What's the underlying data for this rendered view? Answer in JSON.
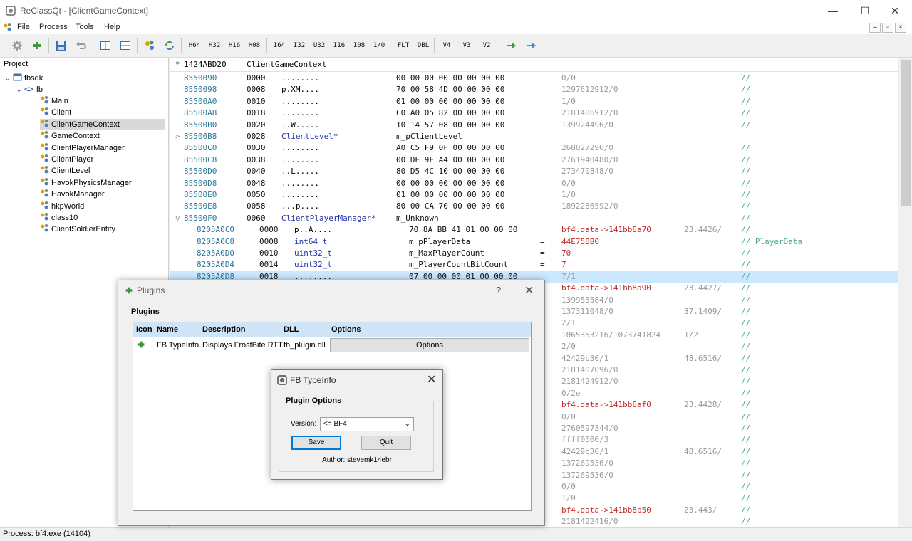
{
  "window": {
    "title": "ReClassQt - [ClientGameContext]",
    "controls": {
      "minimize": "—",
      "maximize": "☐",
      "close": "✕"
    }
  },
  "menu": {
    "items": [
      "File",
      "Process",
      "Tools",
      "Help"
    ],
    "mdi": {
      "minimize": "–",
      "restore": "▫",
      "close": "×"
    }
  },
  "toolbar": {
    "type_buttons": [
      "H64",
      "H32",
      "H16",
      "H08",
      "I64",
      "I32",
      "U32",
      "I16",
      "I08",
      "1/0",
      "FLT",
      "DBL",
      "V4",
      "V3",
      "V2"
    ],
    "icons": [
      "gear-icon",
      "plugin-icon",
      "save-icon",
      "undo-icon",
      "split-vertical-icon",
      "split-horizontal-icon",
      "add-class-icon",
      "refresh-icon",
      "arrow-right-green-icon",
      "arrow-right-blue-icon"
    ]
  },
  "project": {
    "header": "Project",
    "root": "fbsdk",
    "namespace": "fb",
    "classes": [
      "Main",
      "Client",
      "ClientGameContext",
      "GameContext",
      "ClientPlayerManager",
      "ClientPlayer",
      "ClientLevel",
      "HavokPhysicsManager",
      "HavokManager",
      "hkpWorld",
      "class10",
      "ClientSoldierEntity"
    ],
    "selected": "ClientGameContext"
  },
  "hexview": {
    "header_addr": "1424ABD20",
    "header_class": "ClientGameContext",
    "rows": [
      {
        "addr": "8550090",
        "off": "0000",
        "ascii": "........",
        "hex": "00 00 00 00 00 00 00 00",
        "num": "0/0",
        "cmt": "//"
      },
      {
        "addr": "8550098",
        "off": "0008",
        "ascii": "p.XM....",
        "hex": "70 00 58 4D 00 00 00 00",
        "num": "1297612912/0",
        "cmt": "//"
      },
      {
        "addr": "85500A0",
        "off": "0010",
        "ascii": "........",
        "hex": "01 00 00 00 00 00 00 00",
        "num": "1/0",
        "cmt": "//"
      },
      {
        "addr": "85500A8",
        "off": "0018",
        "ascii": "........",
        "hex": "C0 A0 05 82 00 00 00 00",
        "num": "2181406912/0",
        "cmt": "//"
      },
      {
        "addr": "85500B0",
        "off": "0020",
        "ascii": "..W.....",
        "hex": "10 14 57 08 00 00 00 00",
        "num": "139924496/0",
        "cmt": "//"
      },
      {
        "addr": "85500B8",
        "off": "0028",
        "ptr": "ClientLevel*",
        "name": "m_pClientLevel",
        "expand": ">"
      },
      {
        "addr": "85500C0",
        "off": "0030",
        "ascii": "........",
        "hex": "A0 C5 F9 0F 00 00 00 00",
        "num": "268027296/0",
        "cmt": "//"
      },
      {
        "addr": "85500C8",
        "off": "0038",
        "ascii": "........",
        "hex": "00 DE 9F A4 00 00 00 00",
        "num": "2761940480/0",
        "cmt": "//"
      },
      {
        "addr": "85500D0",
        "off": "0040",
        "ascii": "..L.....",
        "hex": "80 D5 4C 10 00 00 00 00",
        "num": "273470848/0",
        "cmt": "//"
      },
      {
        "addr": "85500D8",
        "off": "0048",
        "ascii": "........",
        "hex": "00 00 00 00 00 00 00 00",
        "num": "0/0",
        "cmt": "//"
      },
      {
        "addr": "85500E0",
        "off": "0050",
        "ascii": "........",
        "hex": "01 00 00 00 00 00 00 00",
        "num": "1/0",
        "cmt": "//"
      },
      {
        "addr": "85500E8",
        "off": "0058",
        "ascii": "...p....",
        "hex": "80 00 CA 70 00 00 00 00",
        "num": "1892286592/0",
        "cmt": "//"
      },
      {
        "addr": "85500F0",
        "off": "0060",
        "ptr": "ClientPlayerManager*",
        "name": "m_Unknown",
        "expand": "v",
        "cmt": "//"
      }
    ],
    "sub_rows": [
      {
        "addr": "8205A0C0",
        "off": "0000",
        "ascii": "p..A....",
        "hex": "70 8A BB 41 01 00 00 00",
        "val": "bf4.data->141bb8a70",
        "float": "23.4426/",
        "cmt": "//"
      },
      {
        "addr": "8205A0C8",
        "off": "0008",
        "type": "int64_t",
        "name": "m_pPlayerData",
        "eq": "=",
        "val": "44E758B0",
        "cmt": "// PlayerData"
      },
      {
        "addr": "8205A0D0",
        "off": "0010",
        "type": "uint32_t",
        "name": "m_MaxPlayerCount",
        "eq": "=",
        "val": "70",
        "cmt": "//"
      },
      {
        "addr": "8205A0D4",
        "off": "0014",
        "type": "uint32_t",
        "name": "m_PlayerCountBitCount",
        "eq": "=",
        "val": "7",
        "cmt": "//"
      },
      {
        "addr": "8205A0D8",
        "off": "0018",
        "ascii": "........",
        "hex": "07 00 00 00 01 00 00 00",
        "num": "7/1",
        "cmt": "//"
      }
    ],
    "right_rows": [
      {
        "val": "bf4.data->141bb8a90",
        "red": true,
        "float": "23.4427/",
        "cmt": "//"
      },
      {
        "val": "139953584/0",
        "cmt": "//"
      },
      {
        "val": "137311048/0",
        "float": "37.1409/",
        "cmt": "//"
      },
      {
        "val": "2/1",
        "cmt": "//"
      },
      {
        "val": "1065353216/1073741824",
        "float": "1/2",
        "cmt": "//"
      },
      {
        "val": "2/0",
        "cmt": "//"
      },
      {
        "val": "42429b30/1",
        "float": "48.6516/",
        "cmt": "//"
      },
      {
        "val": "2181407096/0",
        "cmt": "//"
      },
      {
        "val": "2181424912/0",
        "cmt": "//"
      },
      {
        "val": "0/2e",
        "cmt": "//"
      },
      {
        "val": "bf4.data->141bb8af0",
        "red": true,
        "float": "23.4428/",
        "cmt": "//"
      },
      {
        "val": "0/0",
        "cmt": "//"
      },
      {
        "val": "2760597344/0",
        "cmt": "//"
      },
      {
        "val": "ffff0000/3",
        "cmt": "//"
      },
      {
        "val": "42429b30/1",
        "float": "48.6516/",
        "cmt": "//"
      },
      {
        "val": "137269536/0",
        "cmt": "//"
      },
      {
        "val": "137269536/0",
        "cmt": "//"
      },
      {
        "val": "0/0",
        "cmt": "//"
      },
      {
        "val": "1/0",
        "cmt": "//"
      },
      {
        "val": "bf4.data->141bb8b50",
        "red": true,
        "float": "23.443/",
        "cmt": "//"
      },
      {
        "val": "2181422416/0",
        "cmt": "//"
      }
    ]
  },
  "plugins_dialog": {
    "title": "Plugins",
    "help": "?",
    "close": "✕",
    "group": "Plugins",
    "columns": [
      "Icon",
      "Name",
      "Description",
      "DLL",
      "Options"
    ],
    "row": {
      "name": "FB TypeInfo",
      "description": "Displays FrostBite RTTI",
      "dll": "fb_plugin.dll",
      "options_button": "Options"
    }
  },
  "fb_dialog": {
    "title": "FB TypeInfo",
    "close": "✕",
    "group": "Plugin Options",
    "version_label": "Version:",
    "version_value": "<= BF4",
    "save": "Save",
    "quit": "Quit",
    "author": "Author:  stevemk14ebr"
  },
  "status": {
    "text": "Process: bf4.exe (14104)"
  }
}
